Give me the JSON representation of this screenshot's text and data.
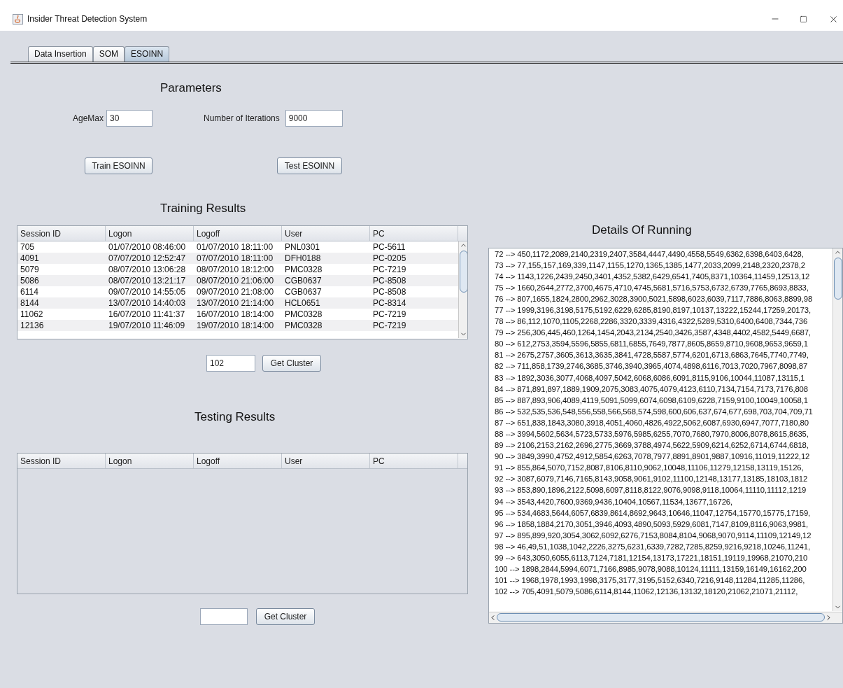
{
  "window": {
    "title": "Insider Threat Detection System"
  },
  "tabs": [
    {
      "label": "Data Insertion",
      "selected": false
    },
    {
      "label": "SOM",
      "selected": false
    },
    {
      "label": "ESOINN",
      "selected": true
    }
  ],
  "parameters": {
    "heading": "Parameters",
    "age_max": {
      "label": "AgeMax",
      "value": "30"
    },
    "iterations": {
      "label": "Number of Iterations",
      "value": "9000"
    },
    "train_button": "Train ESOINN",
    "test_button": "Test ESOINN"
  },
  "training": {
    "heading": "Training Results",
    "columns": [
      "Session ID",
      "Logon",
      "Logoff",
      "User",
      "PC"
    ],
    "rows": [
      [
        "705",
        "01/07/2010 08:46:00",
        "01/07/2010 18:11:00",
        "PNL0301",
        "PC-5611"
      ],
      [
        "4091",
        "07/07/2010 12:52:47",
        "07/07/2010 18:11:00",
        "DFH0188",
        "PC-0205"
      ],
      [
        "5079",
        "08/07/2010 13:06:28",
        "08/07/2010 18:12:00",
        "PMC0328",
        "PC-7219"
      ],
      [
        "5086",
        "08/07/2010 13:21:17",
        "08/07/2010 21:06:00",
        "CGB0637",
        "PC-8508"
      ],
      [
        "6114",
        "09/07/2010 14:55:05",
        "09/07/2010 21:08:00",
        "CGB0637",
        "PC-8508"
      ],
      [
        "8144",
        "13/07/2010 14:40:03",
        "13/07/2010 21:14:00",
        "HCL0651",
        "PC-8314"
      ],
      [
        "11062",
        "16/07/2010 11:41:37",
        "16/07/2010 18:14:00",
        "PMC0328",
        "PC-7219"
      ],
      [
        "12136",
        "19/07/2010 11:46:09",
        "19/07/2010 18:14:00",
        "PMC0328",
        "PC-7219"
      ]
    ],
    "cluster_value": "102",
    "button": "Get Cluster"
  },
  "testing": {
    "heading": "Testing Results",
    "columns": [
      "Session ID",
      "Logon",
      "Logoff",
      "User",
      "PC"
    ],
    "button": "Get Cluster"
  },
  "details": {
    "heading": "Details Of Running",
    "lines": [
      "72 --> 450,1172,2089,2140,2319,2407,3584,4447,4490,4558,5549,6362,6398,6403,6428,",
      "73 --> 77,155,157,169,339,1147,1155,1270,1365,1385,1477,2033,2099,2148,2320,2378,2",
      "74 --> 1143,1226,2439,2450,3401,4352,5382,6429,6541,7405,8371,10364,11459,12513,12",
      "75 --> 1660,2644,2772,3700,4675,4710,4745,5681,5716,5753,6732,6739,7765,8693,8833,",
      "76 --> 807,1655,1824,2800,2962,3028,3900,5021,5898,6023,6039,7117,7886,8063,8899,98",
      "77 --> 1999,3196,3198,5175,5192,6229,6285,8190,8197,10137,13222,15244,17259,20173,",
      "78 --> 86,112,1070,1105,2268,2286,3320,3339,4316,4322,5289,5310,6400,6408,7344,736",
      "79 --> 256,306,445,460,1264,1454,2043,2134,2540,3426,3587,4348,4402,4582,5449,6687,",
      "80 --> 612,2753,3594,5596,5855,6811,6855,7649,7877,8605,8659,8710,9608,9653,9659,1",
      "81 --> 2675,2757,3605,3613,3635,3841,4728,5587,5774,6201,6713,6863,7645,7740,7749,",
      "82 --> 711,858,1739,2746,3685,3746,3940,3965,4074,4898,6116,7013,7020,7967,8098,87",
      "83 --> 1892,3036,3077,4068,4097,5042,6068,6086,6091,8115,9106,10044,11087,13115,1",
      "84 --> 871,891,897,1889,1909,2075,3083,4075,4079,4123,6110,7134,7154,7173,7176,808",
      "85 --> 887,893,906,4089,4119,5091,5099,6074,6098,6109,6228,7159,9100,10049,10058,1",
      "86 --> 532,535,536,548,556,558,566,568,574,598,600,606,637,674,677,698,703,704,709,71",
      "87 --> 651,838,1843,3080,3918,4051,4060,4826,4922,5062,6087,6930,6947,7077,7180,80",
      "88 --> 3994,5602,5634,5723,5733,5976,5985,6255,7070,7680,7970,8006,8078,8615,8635,",
      "89 --> 2106,2153,2162,2696,2775,3669,3788,4974,5622,5909,6214,6252,6714,6744,6818,",
      "90 --> 3849,3990,4752,4912,5854,6263,7078,7977,8891,8901,9887,10916,11019,11222,12",
      "91 --> 855,864,5070,7152,8087,8106,8110,9062,10048,11106,11279,12158,13119,15126,",
      "92 --> 3087,6079,7146,7165,8143,9058,9061,9102,11100,12148,13177,13185,18103,1812",
      "93 --> 853,890,1896,2122,5098,6097,8118,8122,9076,9098,9118,10064,11110,11112,1219",
      "94 --> 3543,4420,7600,9369,9436,10404,10567,11534,13677,16726,",
      "95 --> 534,4683,5644,6057,6839,8614,8692,9643,10646,11047,12754,15770,15775,17159,",
      "96 --> 1858,1884,2170,3051,3946,4093,4890,5093,5929,6081,7147,8109,8116,9063,9981,",
      "97 --> 895,899,920,3054,3062,6092,6276,7153,8084,8104,9068,9070,9114,11109,12149,12",
      "98 --> 46,49,51,1038,1042,2226,3275,6231,6339,7282,7285,8259,9216,9218,10246,11241,",
      "99 --> 643,3050,6055,6113,7124,7181,12154,13173,17221,18151,19119,19968,21070,210",
      "100 --> 1898,2844,5994,6071,7166,8985,9078,9088,10124,11111,13159,16149,16162,200",
      "101 --> 1968,1978,1993,1998,3175,3177,3195,5152,6340,7216,9148,11284,11285,11286,",
      "102 --> 705,4091,5079,5086,6114,8144,11062,12136,13132,18120,21062,21071,21112,"
    ]
  }
}
